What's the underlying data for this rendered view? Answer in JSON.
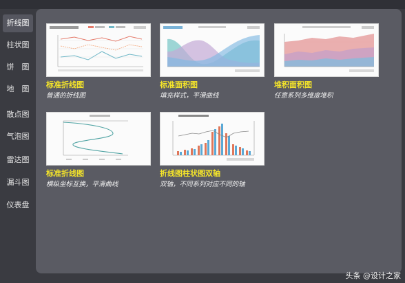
{
  "sidebar": {
    "items": [
      {
        "label": "折线图",
        "active": true
      },
      {
        "label": "柱状图",
        "active": false
      },
      {
        "label": "饼　图",
        "active": false
      },
      {
        "label": "地　图",
        "active": false
      },
      {
        "label": "散点图",
        "active": false
      },
      {
        "label": "气泡图",
        "active": false
      },
      {
        "label": "雷达图",
        "active": false
      },
      {
        "label": "漏斗图",
        "active": false
      },
      {
        "label": "仪表盘",
        "active": false
      }
    ]
  },
  "cards": [
    {
      "title": "标准折线图",
      "desc": "普通的折线图",
      "icon": "line-chart-thumbnail"
    },
    {
      "title": "标准面积图",
      "desc": "填充样式，平滑曲线",
      "icon": "area-chart-thumbnail"
    },
    {
      "title": "堆积面积图",
      "desc": "任意系列多维度堆积",
      "icon": "stacked-area-thumbnail"
    },
    {
      "title": "标准折线图",
      "desc": "横纵坐标互换，平滑曲线",
      "icon": "reversed-axis-line-thumbnail"
    },
    {
      "title": "折线图柱状图双轴",
      "desc": "双轴，不同系列对应不同的轴",
      "icon": "dual-axis-thumbnail"
    }
  ],
  "watermark": "头条 @设计之家",
  "colors": {
    "accent_title": "#f4e42a",
    "panel": "#5a5b63",
    "background": "#3a3b41"
  }
}
